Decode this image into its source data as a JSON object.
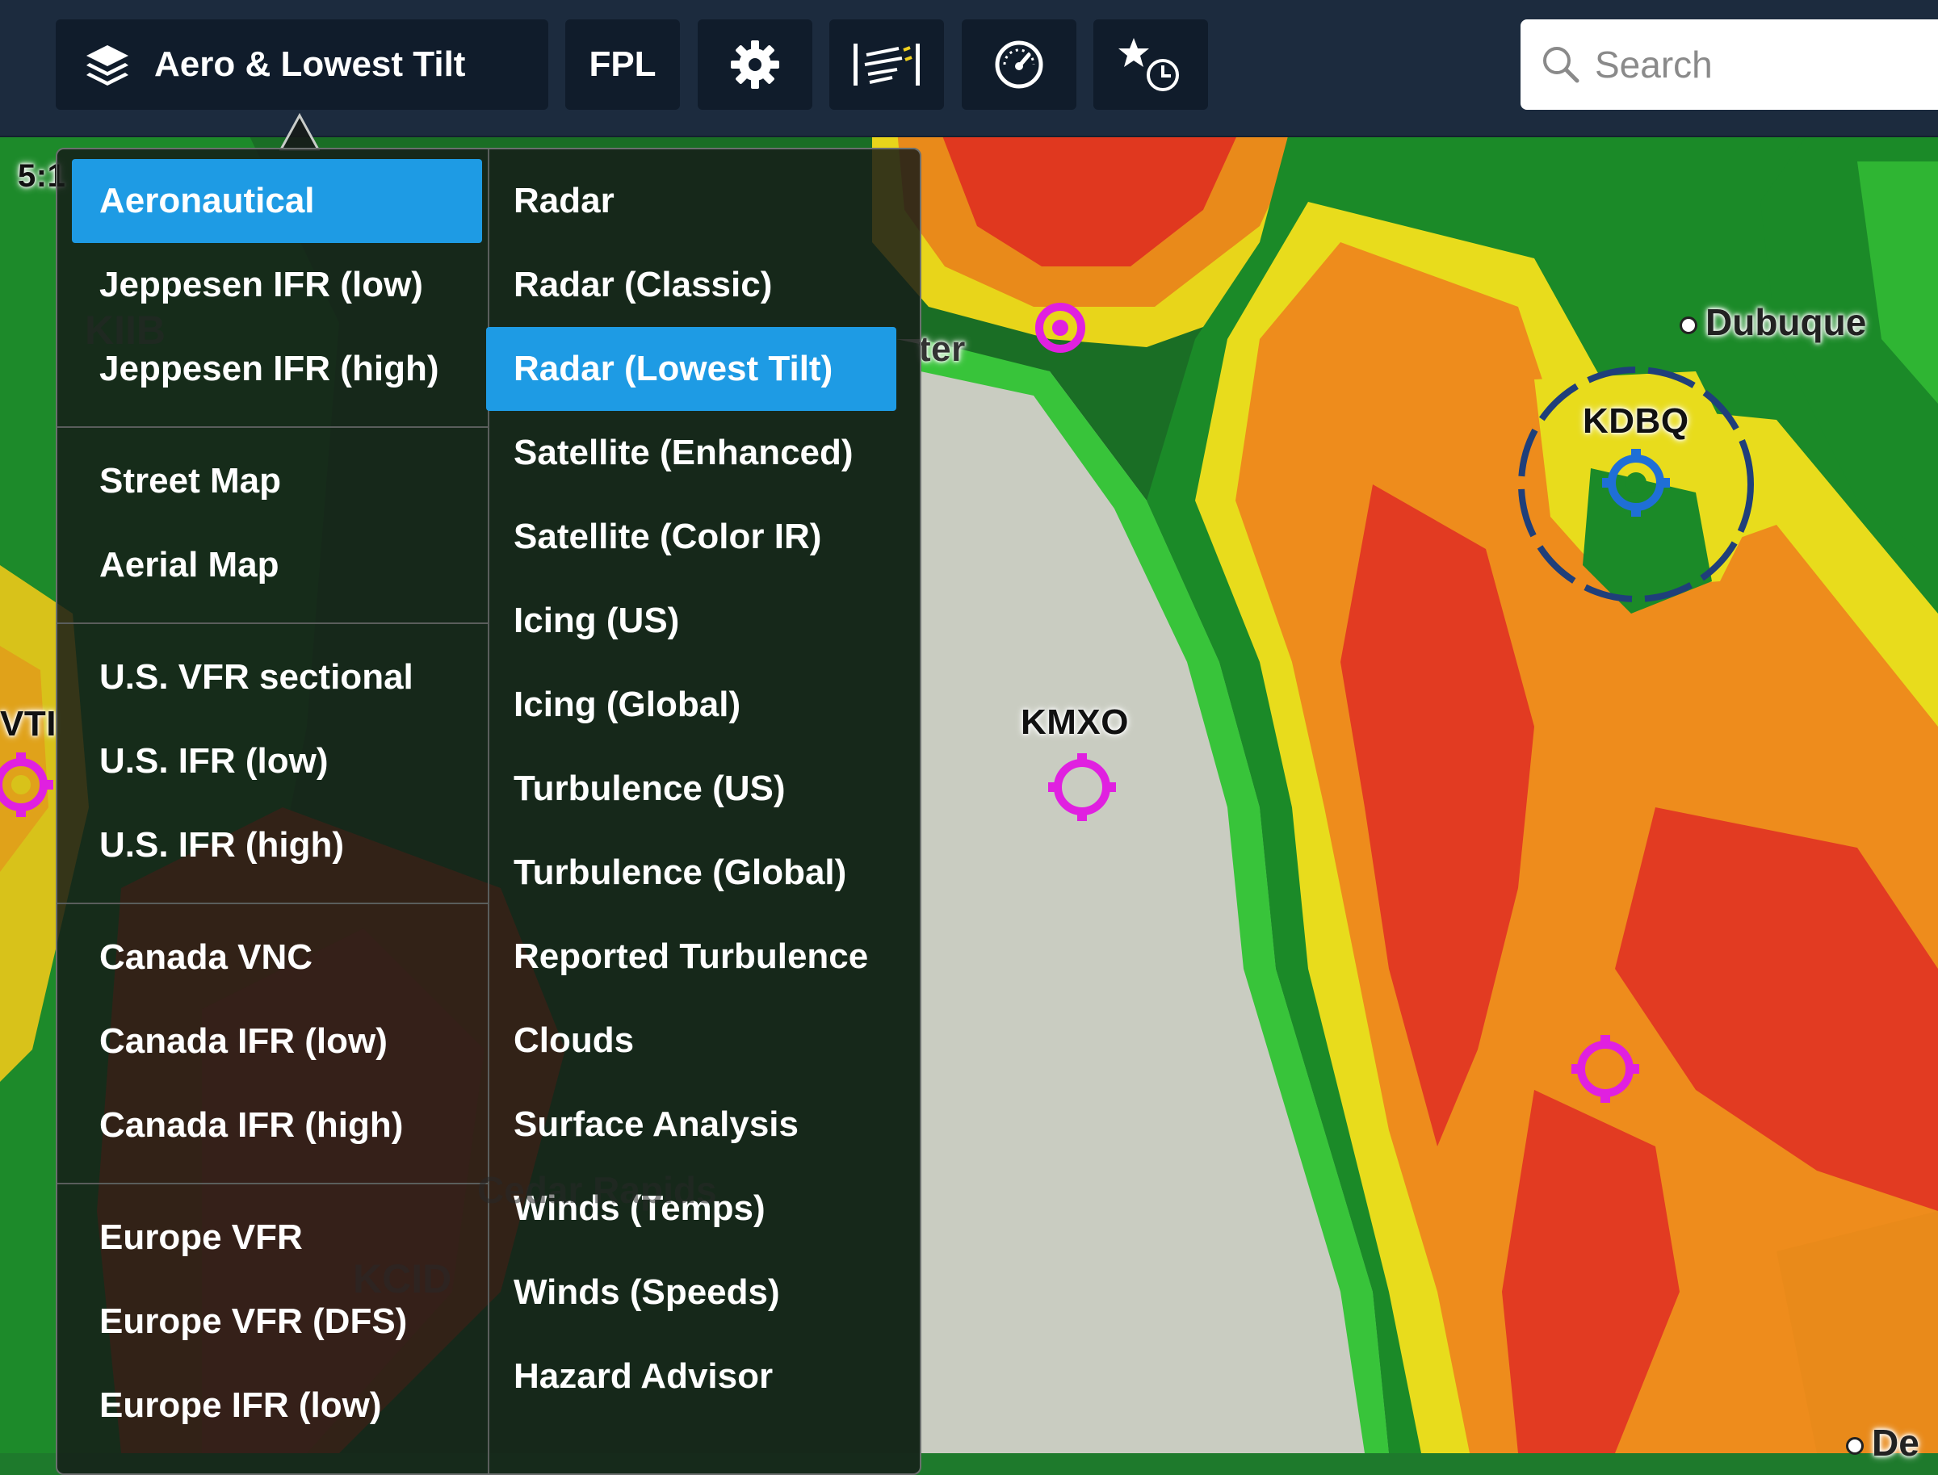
{
  "toolbar": {
    "layers_label": "Aero & Lowest Tilt",
    "fpl_label": "FPL",
    "search_placeholder": "Search"
  },
  "map": {
    "clock_partial": "5:1",
    "airports": [
      "KIIB",
      "KDBQ",
      "KMXO",
      "KCID",
      "VTI"
    ],
    "partial_label": "ter",
    "cities": [
      "Dubuque",
      "Cedar Rapids",
      "De"
    ]
  },
  "menu": {
    "base_maps": [
      {
        "label": "Aeronautical",
        "active": true
      },
      {
        "label": "Jeppesen IFR (low)"
      },
      {
        "label": "Jeppesen IFR (high)"
      },
      {
        "label": "Street Map"
      },
      {
        "label": "Aerial Map"
      },
      {
        "label": "U.S. VFR sectional"
      },
      {
        "label": "U.S. IFR (low)"
      },
      {
        "label": "U.S. IFR (high)"
      },
      {
        "label": "Canada VNC"
      },
      {
        "label": "Canada IFR (low)"
      },
      {
        "label": "Canada IFR (high)"
      },
      {
        "label": "Europe VFR"
      },
      {
        "label": "Europe VFR (DFS)"
      },
      {
        "label": "Europe IFR (low)"
      }
    ],
    "overlays": [
      {
        "label": "Radar"
      },
      {
        "label": "Radar (Classic)"
      },
      {
        "label": "Radar (Lowest Tilt)",
        "active": true
      },
      {
        "label": "Satellite (Enhanced)"
      },
      {
        "label": "Satellite (Color IR)"
      },
      {
        "label": "Icing (US)"
      },
      {
        "label": "Icing (Global)"
      },
      {
        "label": "Turbulence (US)"
      },
      {
        "label": "Turbulence (Global)"
      },
      {
        "label": "Reported Turbulence"
      },
      {
        "label": "Clouds"
      },
      {
        "label": "Surface Analysis"
      },
      {
        "label": "Winds (Temps)"
      },
      {
        "label": "Winds (Speeds)"
      },
      {
        "label": "Hazard Advisor"
      }
    ]
  },
  "colors": {
    "topbar": "#1c2b3e",
    "button": "#101c2b",
    "active_item": "#1e9be4",
    "airport_magenta": "#e020e0",
    "airport_blue": "#1f6fd6"
  }
}
